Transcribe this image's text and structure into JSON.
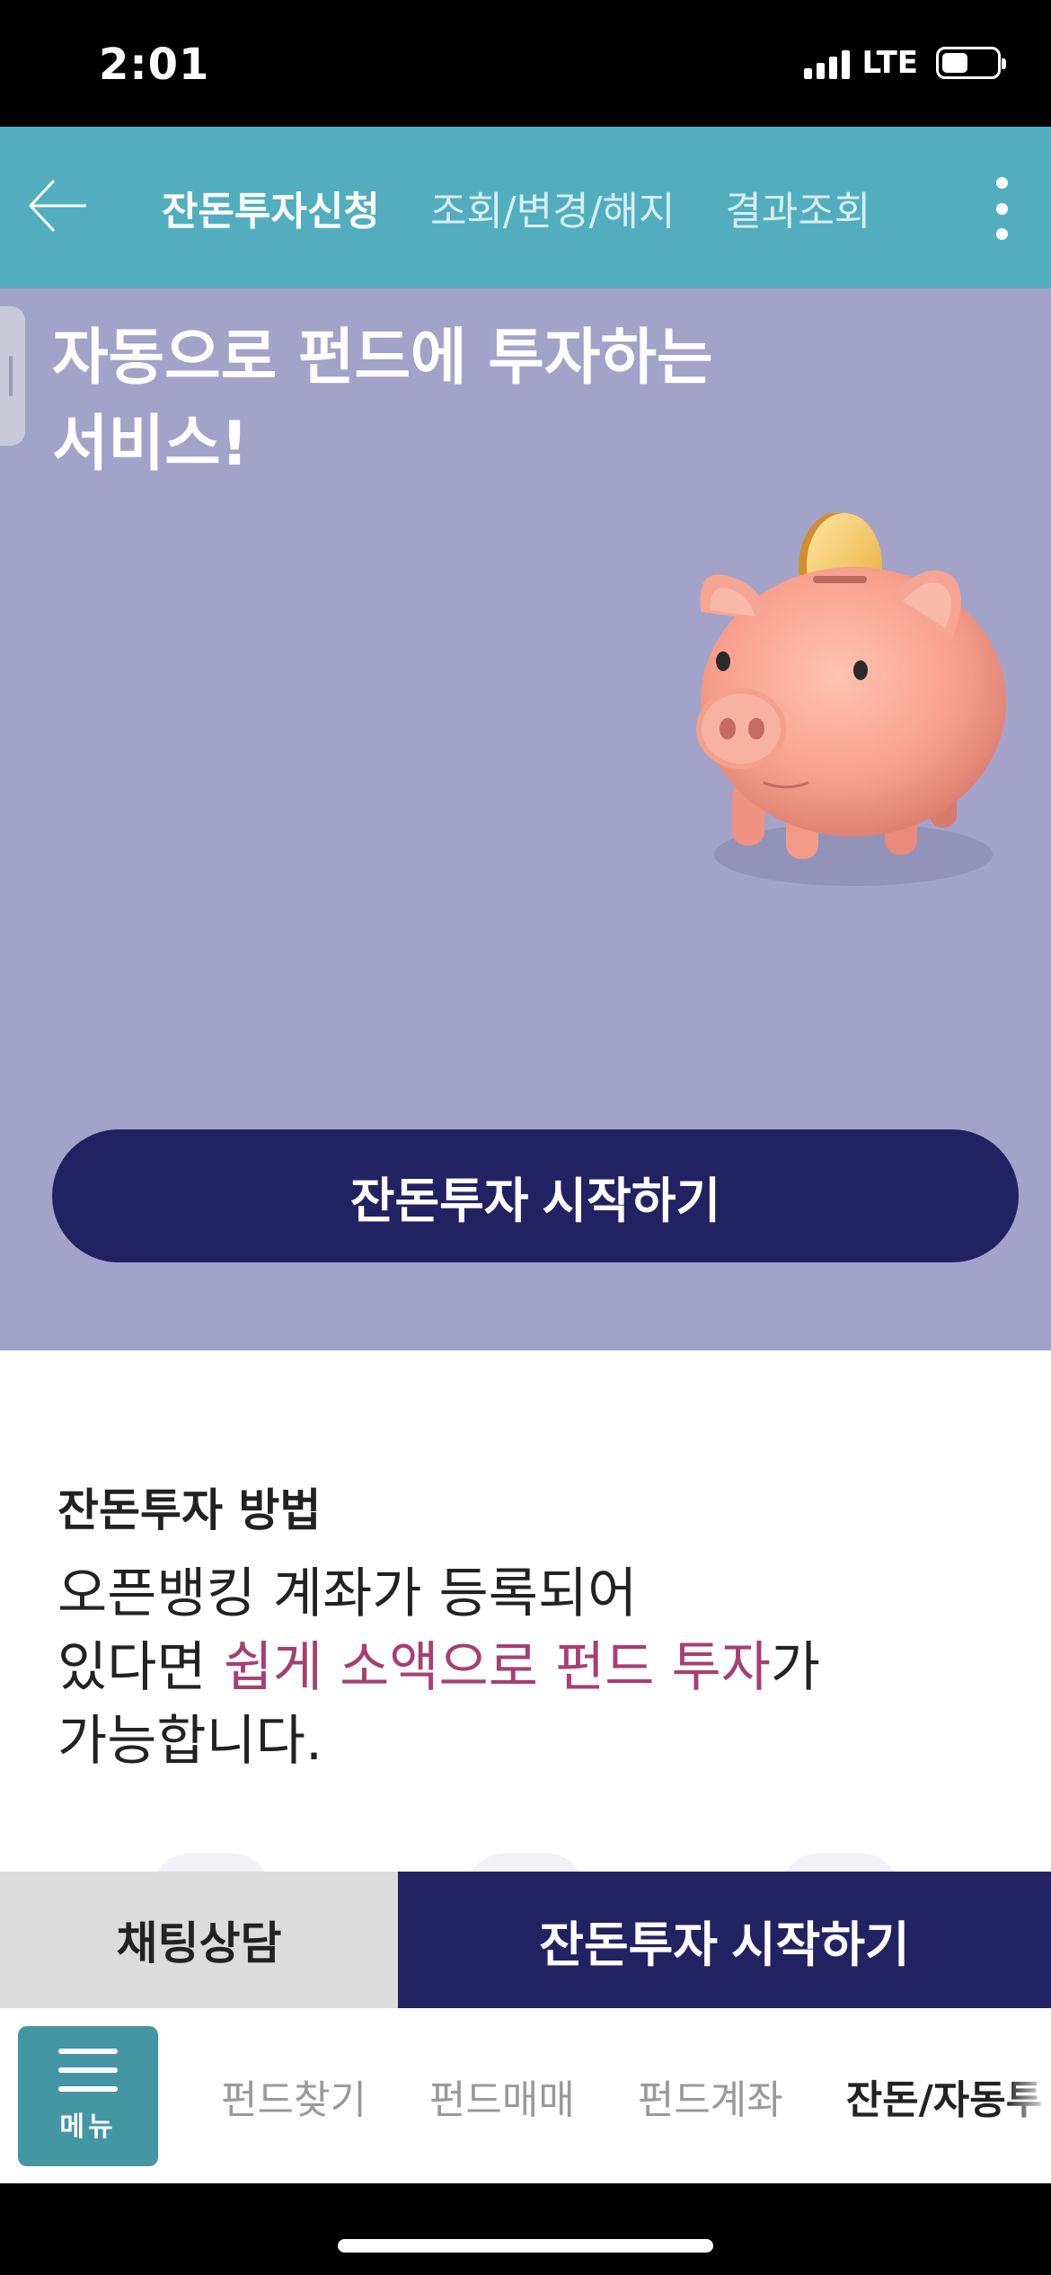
{
  "status_bar": {
    "time": "2:01",
    "network": "LTE",
    "icons": [
      "signal-icon",
      "battery-icon"
    ]
  },
  "top_nav": {
    "back_icon": "back-arrow-icon",
    "tabs": [
      {
        "label": "잔돈투자신청",
        "active": true
      },
      {
        "label": "조회/변경/해지",
        "active": false
      },
      {
        "label": "결과조회",
        "active": false
      }
    ],
    "more_icon": "more-vertical-icon",
    "background": "#52aebe"
  },
  "hero": {
    "title_line1": "자동으로 펀드에 투자하는",
    "title_line2": "서비스!",
    "illustration": "piggy-bank-with-coin",
    "cta_label": "잔돈투자 시작하기",
    "background": "#a3a3c9",
    "cta_color": "#222263"
  },
  "info": {
    "heading": "잔돈투자 방법",
    "body_line1": "오픈뱅킹 계좌가 등록되어",
    "body_line2_pre": "있다면 ",
    "body_line2_highlight": "쉽게 소액으로 펀드 투자",
    "body_line2_post": "가",
    "body_line3": "가능합니다.",
    "highlight_color": "#a63f72"
  },
  "action_bar": {
    "chat_label": "채팅상담",
    "start_label": "잔돈투자 시작하기"
  },
  "bottom_nav": {
    "menu_label": "메뉴",
    "menu_icon": "hamburger-icon",
    "items": [
      {
        "label": "펀드찾기",
        "active": false
      },
      {
        "label": "펀드매매",
        "active": false
      },
      {
        "label": "펀드계좌",
        "active": false
      },
      {
        "label": "잔돈/자동투",
        "active": true
      }
    ]
  }
}
